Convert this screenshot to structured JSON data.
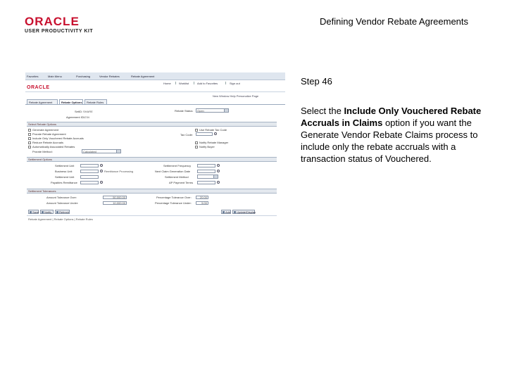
{
  "slide": {
    "logo_word": "ORACLE",
    "logo_sub": "USER PRODUCTIVITY KIT",
    "title": "Defining Vendor Rebate Agreements"
  },
  "instructions": {
    "step": "Step 46",
    "text_before": "Select the ",
    "bold": "Include Only Vouchered Rebate Accruals in Claims",
    "text_after": " option if you want the Generate Vendor Rebate Claims process to include only the rebate accruals with a transaction status of Vouchered."
  },
  "app": {
    "brand": "ORACLE",
    "topbar": [
      "Favorites",
      "Main Menu",
      "Purchasing",
      "Vendor Rebates",
      "Rebate Agreement"
    ],
    "menubar": [
      "Home",
      "Worklist",
      "Add to Favorites",
      "Sign out"
    ],
    "toplinks": "New Window  Help  Personalize Page",
    "tabs": [
      "Rebate Agreement",
      "Rebate Options",
      "Rebate Rules"
    ],
    "header": {
      "setid_label": "SetID:",
      "setid_value": "SHARE",
      "agreement_label": "Agreement ID:",
      "agreement_value": "1234",
      "status_label": "Rebate Status:",
      "status_value": "Open"
    },
    "sections": {
      "options": "Select Rebate Options",
      "settlement": "Settlement Options",
      "tolerance": "Settlement Tolerances"
    },
    "options": {
      "items": [
        "Generate Agreement",
        "Prorate Rebate Agreement",
        "Include Only Vouchered Rebate Accruals",
        "Reduce Rebate Accruals",
        "Automatically Associated Rebates"
      ],
      "right_items": [
        "Use Rebate Tax Code",
        "Notify Rebate Manager",
        "Notify Buyer"
      ],
      "tax_code_label": "Tax Code:",
      "prorate_label": "Prorate Method:",
      "prorate_value": "Calculated"
    },
    "settlement": {
      "fields_left": [
        "Settlement Unit",
        "Business Unit",
        "Settlement Unit",
        "Payables Remittance"
      ],
      "fields_right": [
        "Settlement Frequency",
        "Next Claim Generation Date",
        "Settlement Method",
        "AP Payment Terms"
      ],
      "hint": "Remittance Processing"
    },
    "tolerance": {
      "amount_over_label": "Amount Tolerance Over:",
      "amount_over_value": "50,000.00",
      "amount_under_label": "Amount Tolerance Under:",
      "amount_under_value": "10,000.00",
      "percent_over_label": "Percentage Tolerance Over:",
      "percent_over_value": "20.00",
      "percent_under_label": "Percentage Tolerance Under:",
      "percent_under_value": "5.00"
    },
    "buttons": [
      "Save",
      "Notify",
      "Refresh",
      "Add",
      "Update/Display"
    ],
    "footer": "Rebate Agreement | Rebate Options | Rebate Rules"
  }
}
